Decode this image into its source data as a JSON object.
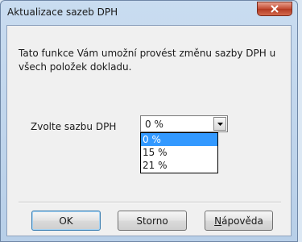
{
  "window": {
    "title": "Aktualizace sazeb DPH",
    "close_icon": "close-icon"
  },
  "dialog": {
    "description": "Tato funkce Vám umožní provést změnu sazby DPH u všech položek dokladu.",
    "prompt_label": "Zvolte sazbu DPH",
    "rate_select": {
      "value": "0 %",
      "options": [
        "0 %",
        "15 %",
        "21 %"
      ],
      "highlighted": "0 %"
    }
  },
  "buttons": {
    "ok": "OK",
    "storno": "Storno",
    "help_underlined_char": "N",
    "help_rest": "ápověda"
  },
  "colors": {
    "selection": "#3399ff",
    "close_button": "#c24b33",
    "window_frame": "#b8cfe8"
  }
}
